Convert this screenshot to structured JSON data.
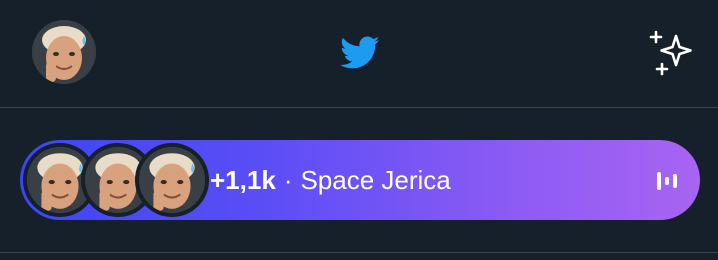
{
  "header": {
    "avatar_icon": "profile-avatar-icon",
    "logo_icon": "twitter-bird-icon",
    "logo_color": "#1d9bf0",
    "sparkle_icon": "sparkle-timeline-icon"
  },
  "space": {
    "listener_count": "+1,1k",
    "separator": "·",
    "name": "Space Jerica",
    "listen_icon": "audio-bars-icon",
    "gradient_start": "#3d46f7",
    "gradient_end": "#a864f2"
  },
  "theme": {
    "background": "#15202b",
    "divider": "#38444d",
    "text": "#ffffff"
  }
}
